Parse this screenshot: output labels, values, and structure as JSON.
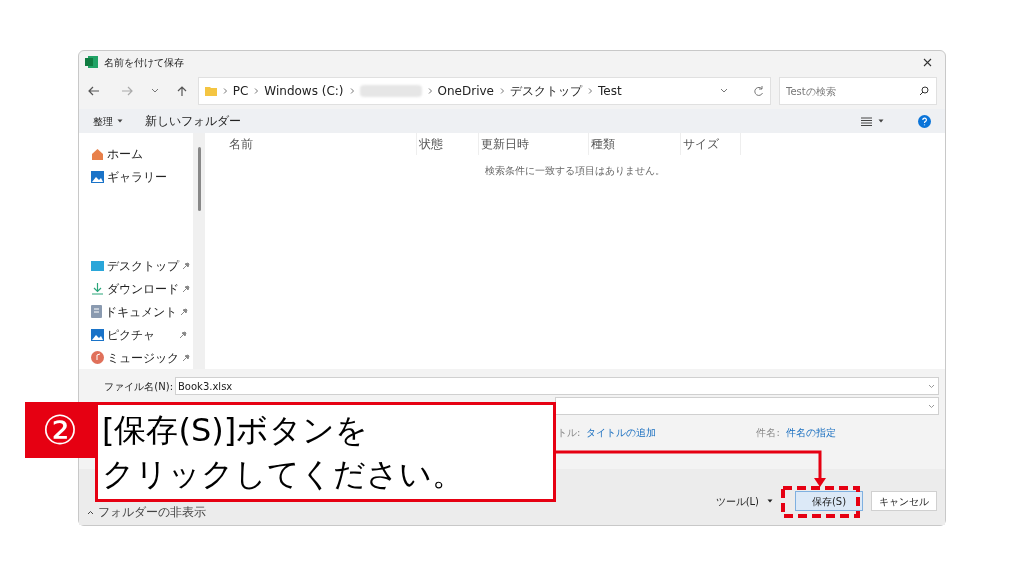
{
  "window": {
    "title": "名前を付けて保存"
  },
  "address_bar": {
    "segments": [
      "PC",
      "Windows (C:)",
      "OneDrive",
      "デスクトップ",
      "Test"
    ]
  },
  "search": {
    "placeholder": "Testの検索"
  },
  "toolbar": {
    "items": [
      "整理",
      "新しいフォルダー"
    ]
  },
  "sidebar": {
    "items": [
      {
        "label": "ホーム",
        "kind": "home",
        "pinned": false
      },
      {
        "label": "ギャラリー",
        "kind": "gallery",
        "pinned": false
      },
      {
        "label": "デスクトップ",
        "kind": "desktop",
        "pinned": true
      },
      {
        "label": "ダウンロード",
        "kind": "download",
        "pinned": true
      },
      {
        "label": "ドキュメント",
        "kind": "document",
        "pinned": true
      },
      {
        "label": "ピクチャ",
        "kind": "picture",
        "pinned": true
      },
      {
        "label": "ミュージック",
        "kind": "music",
        "pinned": true
      }
    ]
  },
  "table": {
    "columns": [
      "名前",
      "状態",
      "更新日時",
      "種類",
      "サイズ"
    ],
    "empty_message": "検索条件に一致する項目はありません。"
  },
  "file_name": {
    "label": "ファイル名(N):",
    "value": "Book3.xlsx"
  },
  "metadata": [
    {
      "label": "トル:",
      "value": "タイトルの追加"
    },
    {
      "label": "件名:",
      "value": "件名の指定"
    }
  ],
  "hide_folders": "フォルダーの非表示",
  "buttons": {
    "tools": "ツール(L)",
    "save": "保存(S)",
    "cancel": "キャンセル"
  },
  "callout": {
    "number": "②",
    "lines": [
      "[保存(S)]ボタンを",
      "クリックしてください。"
    ]
  }
}
